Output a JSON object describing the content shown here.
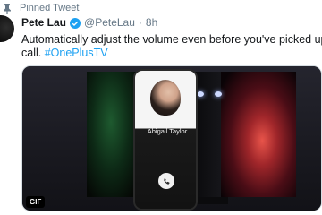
{
  "pinned": {
    "label": "Pinned Tweet",
    "icon": "pin-icon"
  },
  "tweet": {
    "author_name": "Pete Lau",
    "handle": "@PeteLau",
    "separator": "·",
    "time": "8h",
    "text_line1": "Automatically adjust the volume even before you've picked up yo",
    "text_line2_prefix": "call. ",
    "hashtag": "#OnePlusTV",
    "verified_icon": "verified-badge-icon"
  },
  "media": {
    "contact_name": "Abigail Taylor",
    "badge": "GIF",
    "call_icon": "phone-call-icon"
  },
  "colors": {
    "link": "#1da1f2",
    "muted": "#657786",
    "text": "#14171a"
  }
}
